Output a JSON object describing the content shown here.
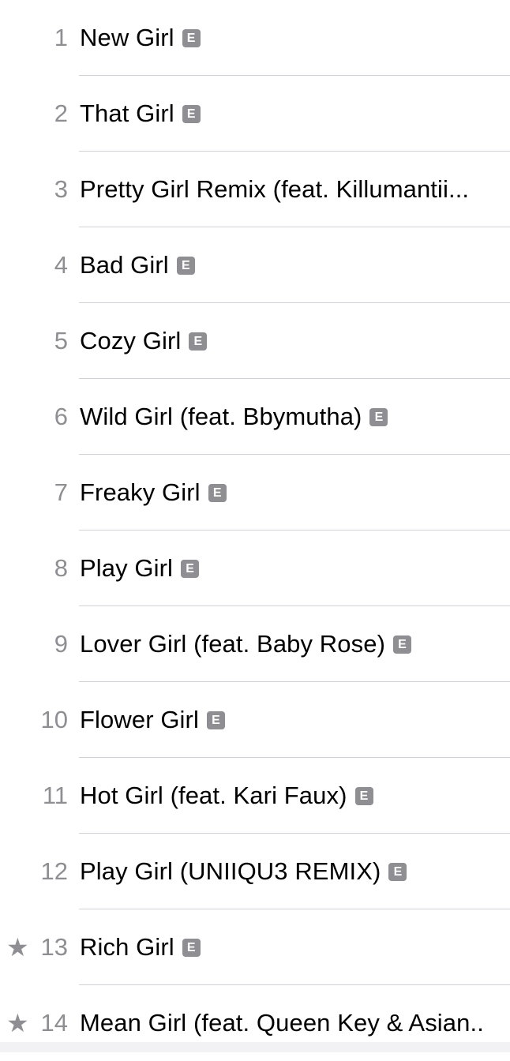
{
  "track_list": {
    "badge_label": "E",
    "star_glyph": "★",
    "tracks": [
      {
        "number": "1",
        "title": "New Girl",
        "explicit": true,
        "starred": false
      },
      {
        "number": "2",
        "title": "That Girl",
        "explicit": true,
        "starred": false
      },
      {
        "number": "3",
        "title": "Pretty Girl Remix (feat. Killumantii...",
        "explicit": false,
        "starred": false
      },
      {
        "number": "4",
        "title": "Bad Girl",
        "explicit": true,
        "starred": false
      },
      {
        "number": "5",
        "title": "Cozy Girl",
        "explicit": true,
        "starred": false
      },
      {
        "number": "6",
        "title": "Wild Girl (feat. Bbymutha)",
        "explicit": true,
        "starred": false
      },
      {
        "number": "7",
        "title": "Freaky Girl",
        "explicit": true,
        "starred": false
      },
      {
        "number": "8",
        "title": "Play Girl",
        "explicit": true,
        "starred": false
      },
      {
        "number": "9",
        "title": "Lover Girl (feat. Baby Rose)",
        "explicit": true,
        "starred": false
      },
      {
        "number": "10",
        "title": "Flower Girl",
        "explicit": true,
        "starred": false
      },
      {
        "number": "11",
        "title": "Hot Girl (feat. Kari Faux)",
        "explicit": true,
        "starred": false
      },
      {
        "number": "12",
        "title": "Play Girl (UNIIQU3 REMIX)",
        "explicit": true,
        "starred": false
      },
      {
        "number": "13",
        "title": "Rich Girl",
        "explicit": true,
        "starred": true
      },
      {
        "number": "14",
        "title": "Mean Girl (feat. Queen Key & Asian..",
        "explicit": false,
        "starred": true
      }
    ]
  },
  "colors": {
    "secondary_text": "#8e8e93",
    "primary_text": "#000000",
    "divider": "#d1d1d6",
    "badge_background": "#8e8e93"
  }
}
